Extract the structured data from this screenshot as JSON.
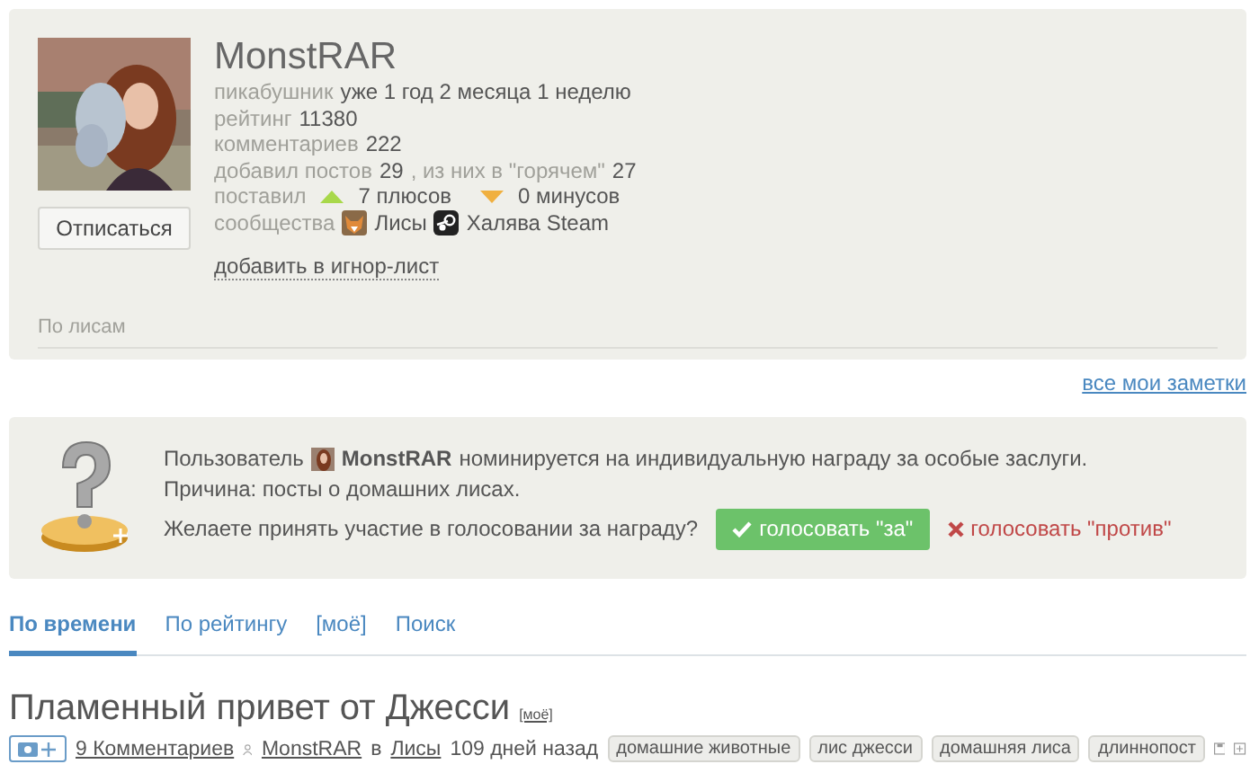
{
  "profile": {
    "name": "MonstRAR",
    "unsubscribe_button": "Отписаться",
    "stats": [
      {
        "label": "пикабушник",
        "value": "уже 1 год 2 месяца 1 неделю"
      },
      {
        "label": "рейтинг",
        "value": "11380"
      },
      {
        "label": "комментариев",
        "value": "222"
      }
    ],
    "posts": {
      "label": "добавил постов",
      "value": "29",
      "hot_label": ", из них в \"горячем\"",
      "hot_value": "27"
    },
    "votes": {
      "label": "поставил",
      "plus": "7 плюсов",
      "minus": "0 минусов"
    },
    "communities": {
      "label": "сообщества",
      "items": [
        {
          "name": "Лисы",
          "kind": "fox"
        },
        {
          "name": "Халява Steam",
          "kind": "steam"
        }
      ]
    },
    "ignore_link": "добавить в игнор-лист",
    "note": "По лисам"
  },
  "notes_link": "все мои заметки",
  "award": {
    "prefix": "Пользователь",
    "user": "MonstRAR",
    "suffix": "номинируется на индивидуальную награду за особые заслуги.",
    "reason": "Причина: посты о домашних лисах.",
    "question": "Желаете принять участие в голосовании за награду?",
    "vote_for": "голосовать \"за\"",
    "vote_against": "голосовать \"против\""
  },
  "tabs": [
    {
      "label": "По времени",
      "selected": true
    },
    {
      "label": "По рейтингу",
      "selected": false
    },
    {
      "label": "[моё]",
      "selected": false
    },
    {
      "label": "Поиск",
      "selected": false
    }
  ],
  "post": {
    "title": "Пламенный привет от Джесси",
    "badge": "[моё]",
    "comments": "9 Комментариев",
    "author": "MonstRAR",
    "in": "в",
    "community": "Лисы",
    "time": "109 дней назад",
    "tags": [
      "домашние животные",
      "лис джесси",
      "домашняя лиса",
      "длиннопост"
    ]
  }
}
